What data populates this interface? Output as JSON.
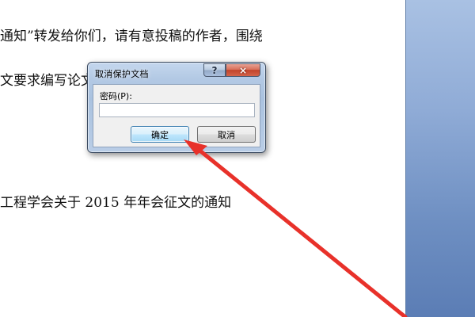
{
  "document": {
    "lines": [
      "通知”转发给你们，请有意投稿的作者，围绕",
      "文要求编写论文，于                   年会秘书",
      "工程学会关于 2015 年年会征文的通知"
    ]
  },
  "dialog": {
    "title": "取消保护文档",
    "help_label": "?",
    "close_label": "×",
    "password_label": "密码(P):",
    "password_value": "",
    "ok_label": "确定",
    "cancel_label": "取消"
  },
  "annotation": {
    "arrow_icon": "red-arrow",
    "arrow_color": "#e8312a"
  },
  "colors": {
    "panel_top": "#a9c1e3",
    "panel_bottom": "#5b7db5",
    "dialog_frame": "#b3c9e4",
    "close_button": "#c2432a"
  }
}
